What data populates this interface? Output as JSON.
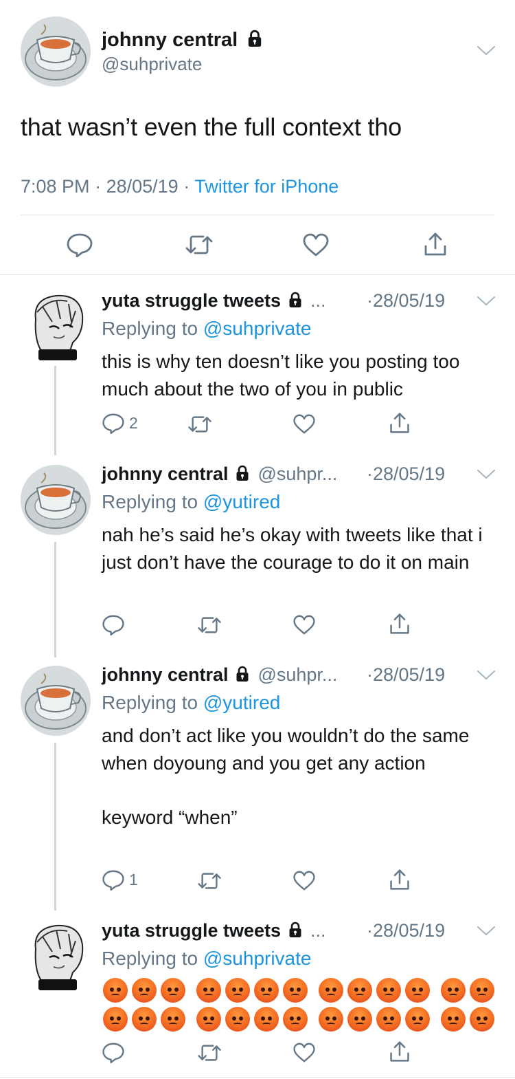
{
  "main_tweet": {
    "name": "johnny central",
    "handle": "@suhprivate",
    "text": "that wasn’t even the full context tho",
    "time": "7:08 PM",
    "date": "28/05/19",
    "source": "Twitter for iPhone",
    "separator": "·"
  },
  "replies": [
    {
      "name": "yuta struggle tweets",
      "handle": "...",
      "date": "·28/05/19",
      "replying_label": "Replying to",
      "replying_to": "@suhprivate",
      "text": "this is why ten doesn’t like you posting too much about the two of you in public",
      "reply_count": "2",
      "avatar": "manga-character-avatar"
    },
    {
      "name": "johnny central",
      "handle": "@suhpr...",
      "date": "·28/05/19",
      "replying_label": "Replying to",
      "replying_to": "@yutired",
      "text": "nah he’s said he’s okay with tweets like that i just don’t have the courage to do it on main",
      "reply_count": "",
      "avatar": "teacup-avatar"
    },
    {
      "name": "johnny central",
      "handle": "@suhpr...",
      "date": "·28/05/19",
      "replying_label": "Replying to",
      "replying_to": "@yutired",
      "text": "and don’t act like you wouldn’t do the same when doyoung and you get any action\n\nkeyword “when”",
      "reply_count": "1",
      "avatar": "teacup-avatar"
    },
    {
      "name": "yuta struggle tweets",
      "handle": "...",
      "date": "·28/05/19",
      "replying_label": "Replying to",
      "replying_to": "@suhprivate",
      "emoji_rows": [
        13,
        13
      ],
      "emoji_name": "angry-face-emoji",
      "reply_count": "",
      "avatar": "manga-character-avatar"
    }
  ],
  "colors": {
    "text": "#14171a",
    "muted": "#657786",
    "link": "#1b95e0",
    "divider": "#e1e8ed",
    "thread_line": "#ccd6dd"
  },
  "icons": [
    "lock-icon",
    "chevron-down-icon",
    "reply-icon",
    "retweet-icon",
    "like-icon",
    "share-icon"
  ]
}
